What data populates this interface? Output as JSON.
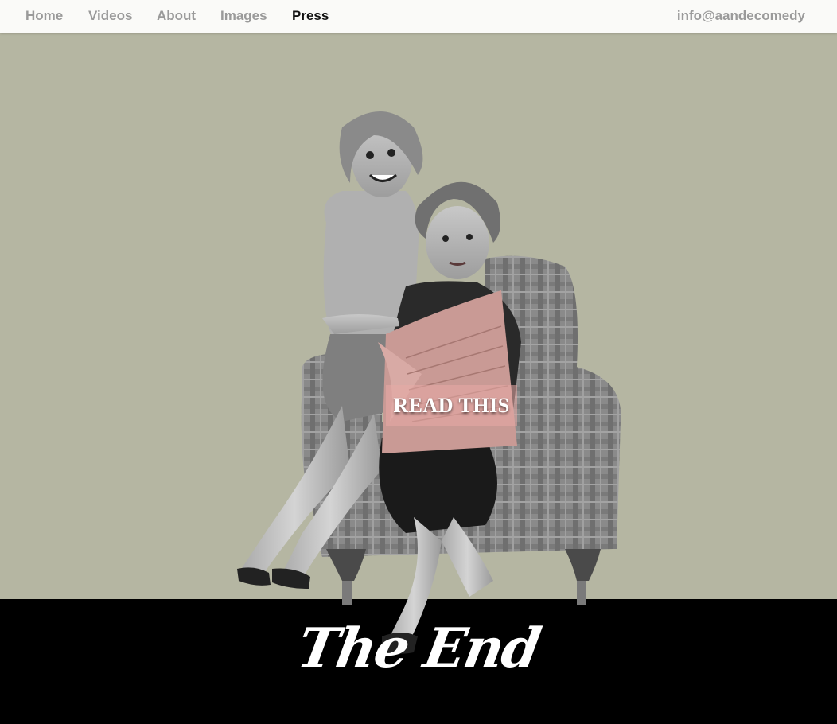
{
  "nav": {
    "items": [
      {
        "label": "Home",
        "active": false
      },
      {
        "label": "Videos",
        "active": false
      },
      {
        "label": "About",
        "active": false
      },
      {
        "label": "Images",
        "active": false
      },
      {
        "label": "Press",
        "active": true
      }
    ],
    "email": "info@aandecomedy"
  },
  "hero": {
    "button_label": "READ THIS",
    "illustration_icon": "two-women-reading-newspaper-on-armchair-illustration"
  },
  "footer": {
    "title": "The End"
  },
  "colors": {
    "background": "#b5b6a2",
    "nav_background": "#fafaf8",
    "nav_text": "#9a9a9a",
    "nav_active": "#111111",
    "footer_background": "#000000",
    "newspaper_tint": "#e8aaa5"
  }
}
